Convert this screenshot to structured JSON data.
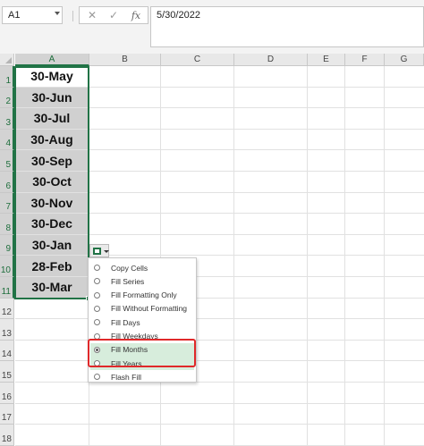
{
  "formula_bar": {
    "name_box": "A1",
    "fx_label": "fx",
    "cancel_icon": "cancel-icon",
    "enter_icon": "check-icon",
    "formula_value": "5/30/2022"
  },
  "columns": [
    "A",
    "B",
    "C",
    "D",
    "E",
    "F",
    "G"
  ],
  "rows": [
    "1",
    "2",
    "3",
    "4",
    "5",
    "6",
    "7",
    "8",
    "9",
    "10",
    "11",
    "12",
    "13",
    "14",
    "15",
    "16",
    "17",
    "18"
  ],
  "cells_a": [
    "30-May",
    "30-Jun",
    "30-Jul",
    "30-Aug",
    "30-Sep",
    "30-Oct",
    "30-Nov",
    "30-Dec",
    "30-Jan",
    "28-Feb",
    "30-Mar"
  ],
  "autofill_menu": {
    "button_icon": "auto-fill-options-icon",
    "items": [
      {
        "label": "Copy Cells",
        "selected": false
      },
      {
        "label": "Fill Series",
        "selected": false
      },
      {
        "label": "Fill Formatting Only",
        "selected": false
      },
      {
        "label": "Fill Without Formatting",
        "selected": false
      },
      {
        "label": "Fill Days",
        "selected": false
      },
      {
        "label": "Fill Weekdays",
        "selected": false
      },
      {
        "label": "Fill Months",
        "selected": true
      },
      {
        "label": "Fill Years",
        "selected": false
      },
      {
        "label": "Flash Fill",
        "selected": false
      }
    ]
  },
  "colors": {
    "selection": "#217346",
    "highlight_box": "#e0292a",
    "hover_item": "#d7eddc",
    "selected_cell_fill": "#d0d0d0"
  }
}
